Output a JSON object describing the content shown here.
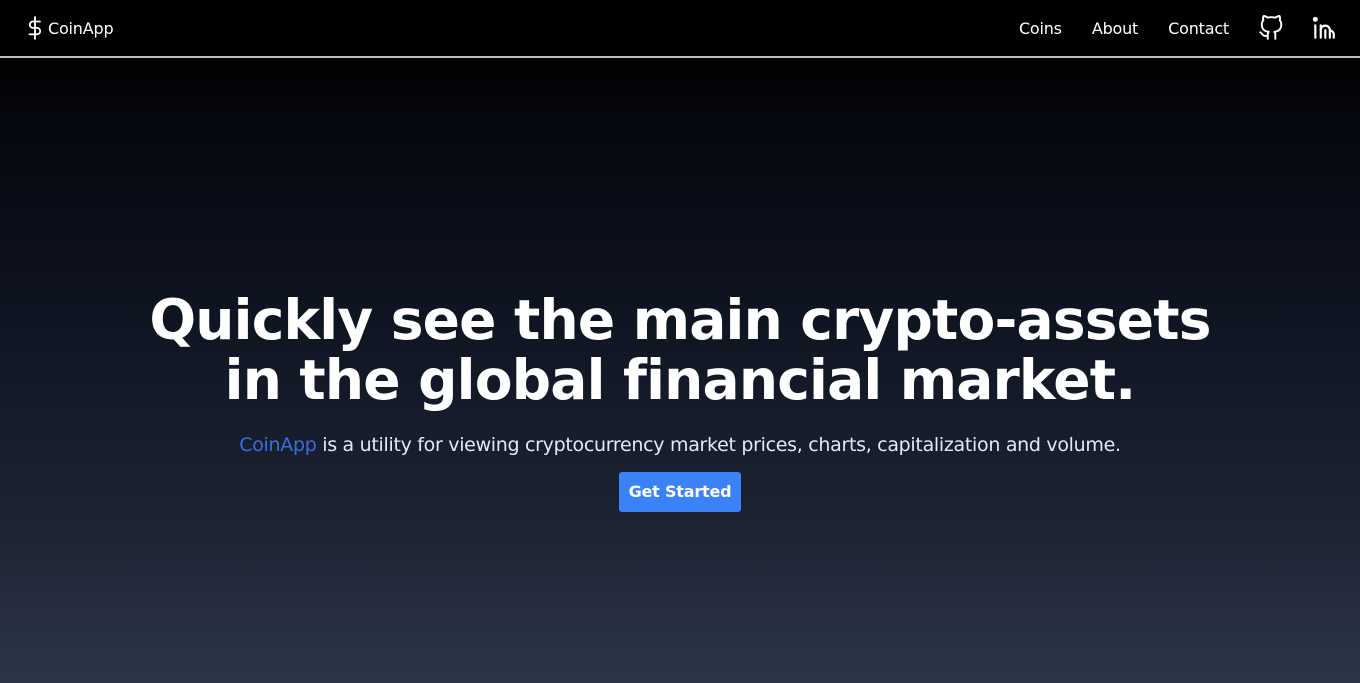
{
  "nav": {
    "brand": {
      "icon": "dollar-sign-icon",
      "label": "CoinApp"
    },
    "links": [
      {
        "label": "Coins"
      },
      {
        "label": "About"
      },
      {
        "label": "Contact"
      }
    ],
    "icons": [
      "github-icon",
      "linkedin-icon"
    ]
  },
  "hero": {
    "title_line1": "Quickly see the main crypto-assets",
    "title_line2": "in the global financial market.",
    "subtitle_brand": "CoinApp",
    "subtitle_rest": " is a utility for viewing cryptocurrency market prices, charts, capitalization and volume.",
    "cta_label": "Get Started"
  },
  "colors": {
    "accent": "#3b82f6",
    "brand_text": "#3b6de0",
    "navbar_bg": "#000000",
    "background_bottom": "#2c3547"
  }
}
